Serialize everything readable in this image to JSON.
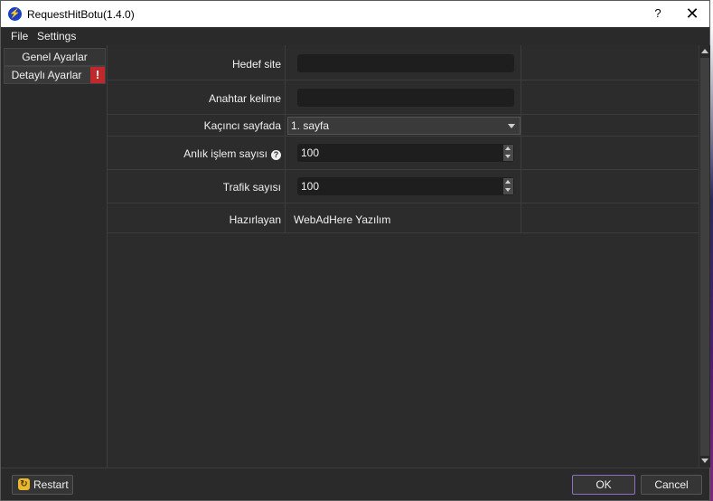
{
  "window": {
    "title": "RequestHitBotu(1.4.0)",
    "help_glyph": "?",
    "close_glyph": "✕",
    "app_icon_glyph": "⚡"
  },
  "menu": {
    "file": "File",
    "settings": "Settings"
  },
  "sidebar": {
    "items": [
      {
        "label": "Genel Ayarlar"
      },
      {
        "label": "Detaylı Ayarlar",
        "warning": "!"
      }
    ]
  },
  "form": {
    "hedef_site": {
      "label": "Hedef site",
      "value": ""
    },
    "anahtar_kelime": {
      "label": "Anahtar kelime",
      "value": ""
    },
    "kacinci_sayfada": {
      "label": "Kaçıncı sayfada",
      "selected": "1. sayfa"
    },
    "anlik_islem": {
      "label": "Anlık işlem sayısı",
      "value": "100",
      "help_glyph": "?"
    },
    "trafik_sayisi": {
      "label": "Trafik sayısı",
      "value": "100"
    },
    "hazirlayan": {
      "label": "Hazırlayan",
      "value": "WebAdHere Yazılım"
    }
  },
  "buttons": {
    "restart": "Restart",
    "ok": "OK",
    "cancel": "Cancel"
  },
  "colors": {
    "accent_border": "#8a6fc0",
    "warning": "#c0282b",
    "app_icon": "#1a3fbf"
  }
}
